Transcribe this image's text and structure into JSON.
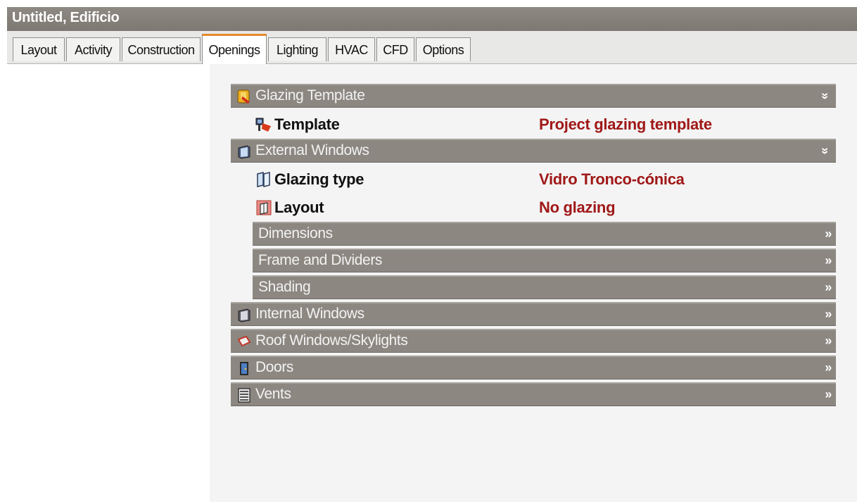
{
  "window": {
    "title": "Untitled, Edificio"
  },
  "tabs": [
    {
      "label": "Layout",
      "active": false
    },
    {
      "label": "Activity",
      "active": false
    },
    {
      "label": "Construction",
      "active": false
    },
    {
      "label": "Openings",
      "active": true
    },
    {
      "label": "Lighting",
      "active": false
    },
    {
      "label": "HVAC",
      "active": false
    },
    {
      "label": "CFD",
      "active": false
    },
    {
      "label": "Options",
      "active": false
    }
  ],
  "sections": {
    "glazing_template": {
      "label": "Glazing Template",
      "icon": "glazing-template-icon",
      "expanded": true,
      "template": {
        "label": "Template",
        "value": "Project glazing template",
        "icon": "template-icon"
      }
    },
    "external_windows": {
      "label": "External Windows",
      "icon": "external-window-icon",
      "expanded": true,
      "glazing_type": {
        "label": "Glazing type",
        "value": "Vidro Tronco-cónica",
        "icon": "glazing-type-icon"
      },
      "layout": {
        "label": "Layout",
        "value": "No glazing",
        "icon": "window-layout-icon"
      },
      "subsections": [
        {
          "label": "Dimensions"
        },
        {
          "label": "Frame and Dividers"
        },
        {
          "label": "Shading"
        }
      ]
    },
    "internal_windows": {
      "label": "Internal Windows",
      "icon": "internal-window-icon"
    },
    "roof_windows": {
      "label": "Roof Windows/Skylights",
      "icon": "skylight-icon"
    },
    "doors": {
      "label": "Doors",
      "icon": "door-icon"
    },
    "vents": {
      "label": "Vents",
      "icon": "vent-icon"
    }
  },
  "glyphs": {
    "collapse": "»",
    "expanded": "»"
  },
  "colors": {
    "title_bar": "#857f79",
    "section_bar": "#8c8781",
    "value_text": "#a01818",
    "active_tab_accent": "#e58a2b"
  }
}
